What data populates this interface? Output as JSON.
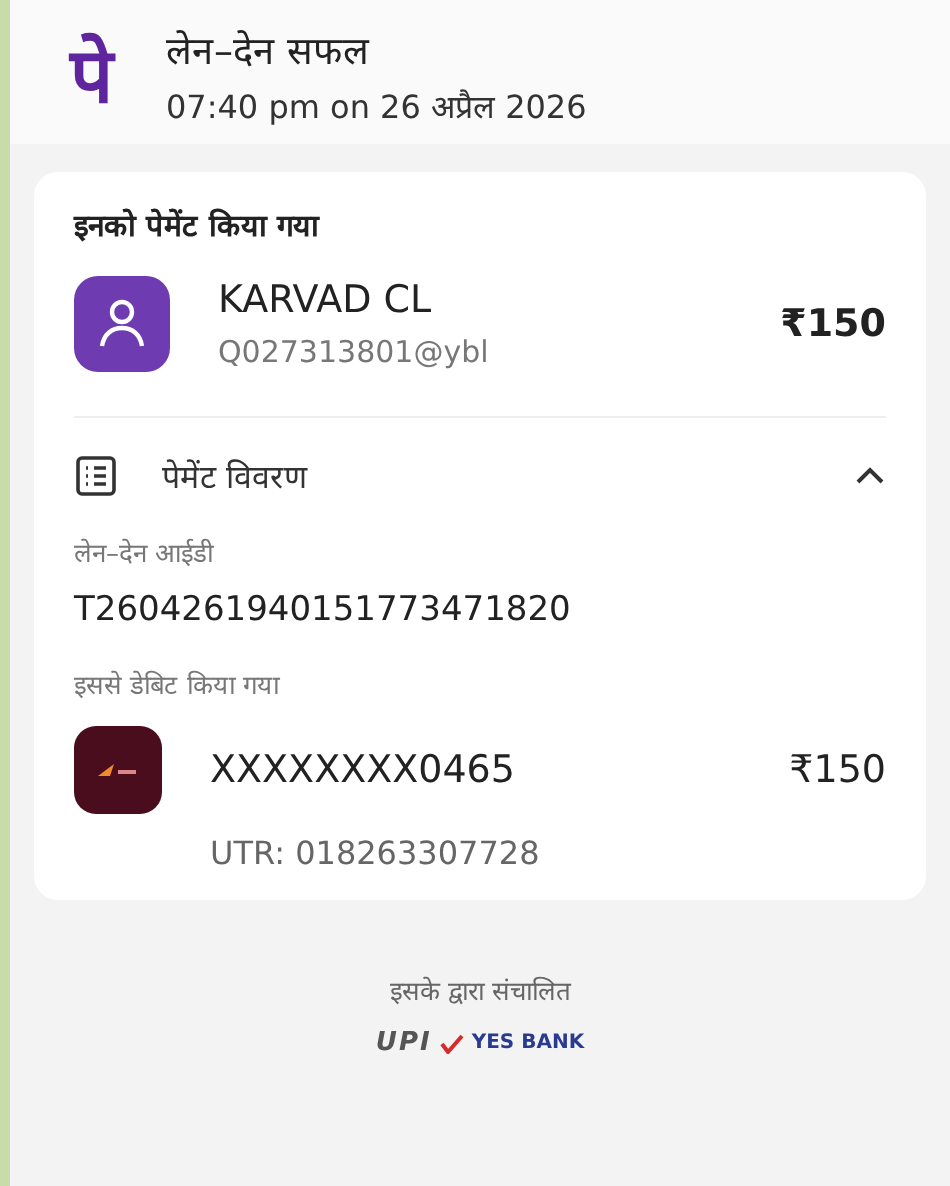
{
  "header": {
    "logo": "पे",
    "title": "लेन–देन सफल",
    "timestamp": "07:40 pm on 26 अप्रैल 2026"
  },
  "paid_to": {
    "heading": "इनको पेमेंट किया गया",
    "name": "KARVAD CL",
    "upi_id": "Q027313801@ybl",
    "amount": "₹150"
  },
  "payment_details": {
    "title": "पेमेंट विवरण",
    "expanded": true,
    "transaction_id_label": "लेन–देन आईडी",
    "transaction_id": "T2604261940151773471820",
    "debited_from_label": "इससे डेबिट किया गया",
    "account": "XXXXXXXX0465",
    "amount": "₹150",
    "utr": "UTR: 018263307728"
  },
  "footer": {
    "powered_by": "इसके द्वारा संचालित",
    "upi": "UPI",
    "bank": "YES BANK"
  }
}
